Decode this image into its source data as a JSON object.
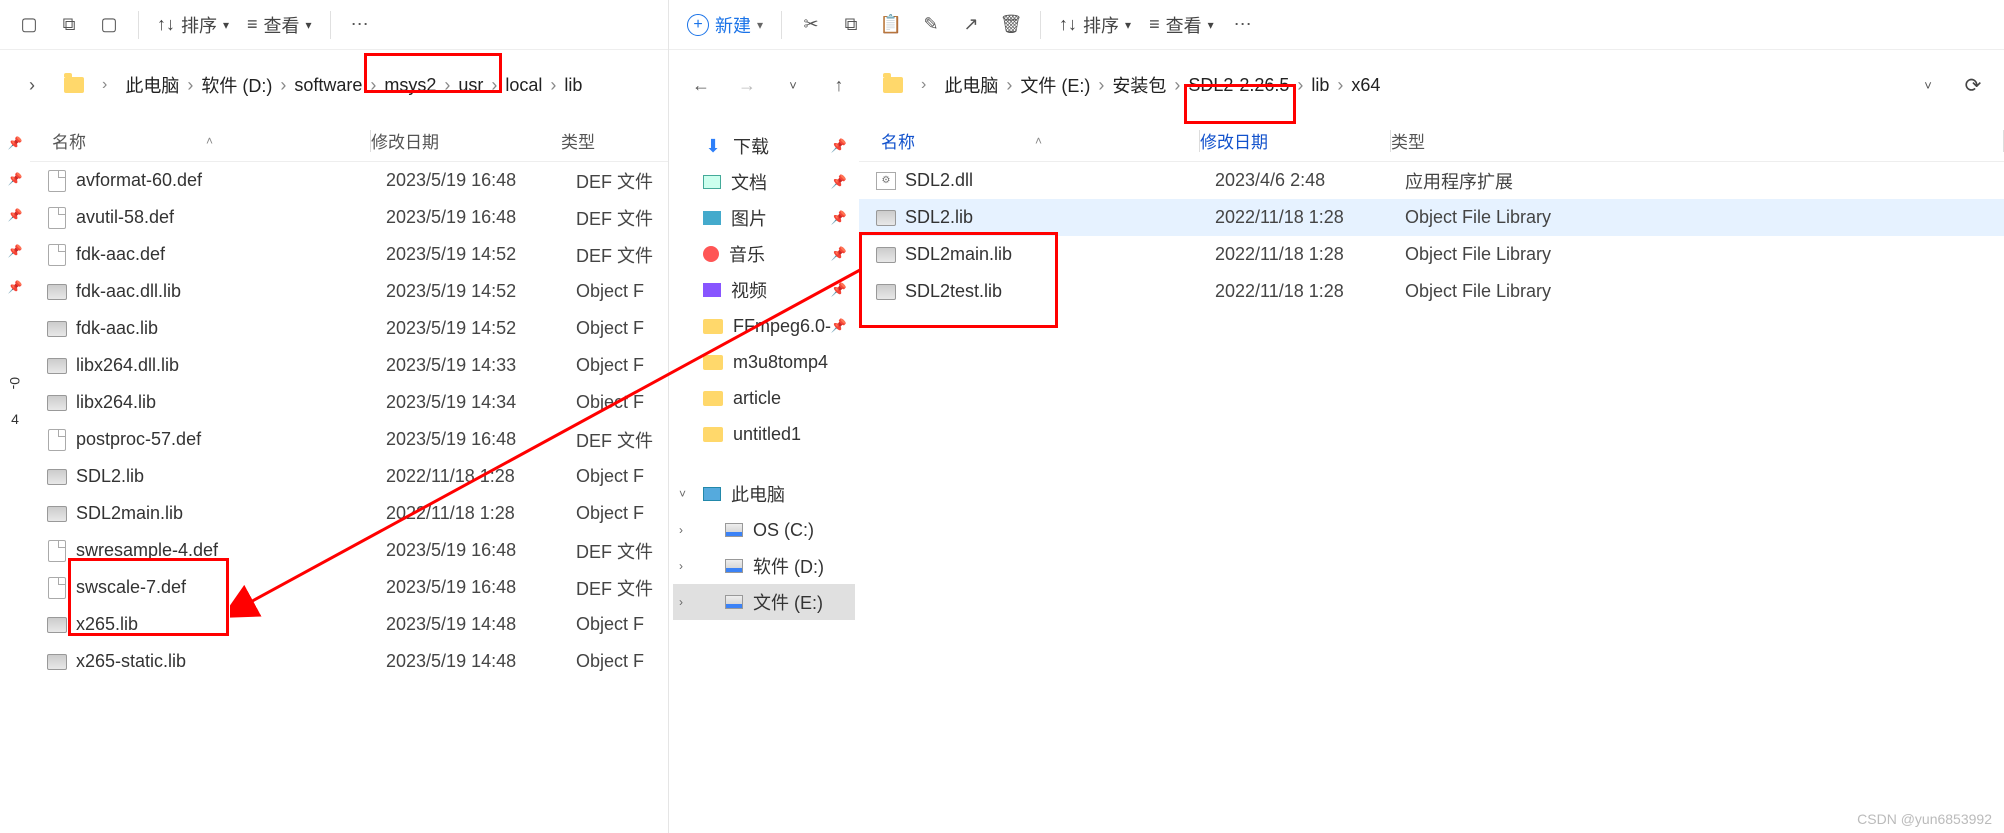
{
  "left": {
    "toolbar": {
      "sort": "排序",
      "view": "查看"
    },
    "breadcrumb": [
      "此电脑",
      "软件 (D:)",
      "software",
      "msys2",
      "usr",
      "local",
      "lib"
    ],
    "columns": {
      "name": "名称",
      "date": "修改日期",
      "type": "类型"
    },
    "files": [
      {
        "name": "avformat-60.def",
        "date": "2023/5/19 16:48",
        "type": "DEF 文件",
        "icon": "def"
      },
      {
        "name": "avutil-58.def",
        "date": "2023/5/19 16:48",
        "type": "DEF 文件",
        "icon": "def"
      },
      {
        "name": "fdk-aac.def",
        "date": "2023/5/19 14:52",
        "type": "DEF 文件",
        "icon": "def"
      },
      {
        "name": "fdk-aac.dll.lib",
        "date": "2023/5/19 14:52",
        "type": "Object F",
        "icon": "lib"
      },
      {
        "name": "fdk-aac.lib",
        "date": "2023/5/19 14:52",
        "type": "Object F",
        "icon": "lib"
      },
      {
        "name": "libx264.dll.lib",
        "date": "2023/5/19 14:33",
        "type": "Object F",
        "icon": "lib"
      },
      {
        "name": "libx264.lib",
        "date": "2023/5/19 14:34",
        "type": "Object F",
        "icon": "lib"
      },
      {
        "name": "postproc-57.def",
        "date": "2023/5/19 16:48",
        "type": "DEF 文件",
        "icon": "def"
      },
      {
        "name": "SDL2.lib",
        "date": "2022/11/18 1:28",
        "type": "Object F",
        "icon": "lib"
      },
      {
        "name": "SDL2main.lib",
        "date": "2022/11/18 1:28",
        "type": "Object F",
        "icon": "lib"
      },
      {
        "name": "swresample-4.def",
        "date": "2023/5/19 16:48",
        "type": "DEF 文件",
        "icon": "def"
      },
      {
        "name": "swscale-7.def",
        "date": "2023/5/19 16:48",
        "type": "DEF 文件",
        "icon": "def"
      },
      {
        "name": "x265.lib",
        "date": "2023/5/19 14:48",
        "type": "Object F",
        "icon": "lib"
      },
      {
        "name": "x265-static.lib",
        "date": "2023/5/19 14:48",
        "type": "Object F",
        "icon": "lib"
      }
    ]
  },
  "right": {
    "toolbar": {
      "new": "新建",
      "sort": "排序",
      "view": "查看"
    },
    "breadcrumb": [
      "此电脑",
      "文件 (E:)",
      "安装包",
      "SDL2-2.26.5",
      "lib",
      "x64"
    ],
    "columns": {
      "name": "名称",
      "date": "修改日期",
      "type": "类型"
    },
    "sidebar": {
      "quick": [
        {
          "label": "下载",
          "icon": "down",
          "pin": true
        },
        {
          "label": "文档",
          "icon": "doc",
          "pin": true
        },
        {
          "label": "图片",
          "icon": "pic",
          "pin": true
        },
        {
          "label": "音乐",
          "icon": "music",
          "pin": true
        },
        {
          "label": "视频",
          "icon": "video",
          "pin": true
        },
        {
          "label": "FFmpeg6.0-",
          "icon": "folder",
          "pin": true
        },
        {
          "label": "m3u8tomp4",
          "icon": "folder"
        },
        {
          "label": "article",
          "icon": "folder"
        },
        {
          "label": "untitled1",
          "icon": "folder"
        }
      ],
      "pc_label": "此电脑",
      "drives": [
        {
          "label": "OS (C:)"
        },
        {
          "label": "软件 (D:)"
        },
        {
          "label": "文件 (E:)"
        }
      ]
    },
    "files": [
      {
        "name": "SDL2.dll",
        "date": "2023/4/6 2:48",
        "type": "应用程序扩展",
        "icon": "dll"
      },
      {
        "name": "SDL2.lib",
        "date": "2022/11/18 1:28",
        "type": "Object File Library",
        "icon": "lib"
      },
      {
        "name": "SDL2main.lib",
        "date": "2022/11/18 1:28",
        "type": "Object File Library",
        "icon": "lib"
      },
      {
        "name": "SDL2test.lib",
        "date": "2022/11/18 1:28",
        "type": "Object File Library",
        "icon": "lib"
      }
    ]
  },
  "watermark": "CSDN @yun6853992"
}
